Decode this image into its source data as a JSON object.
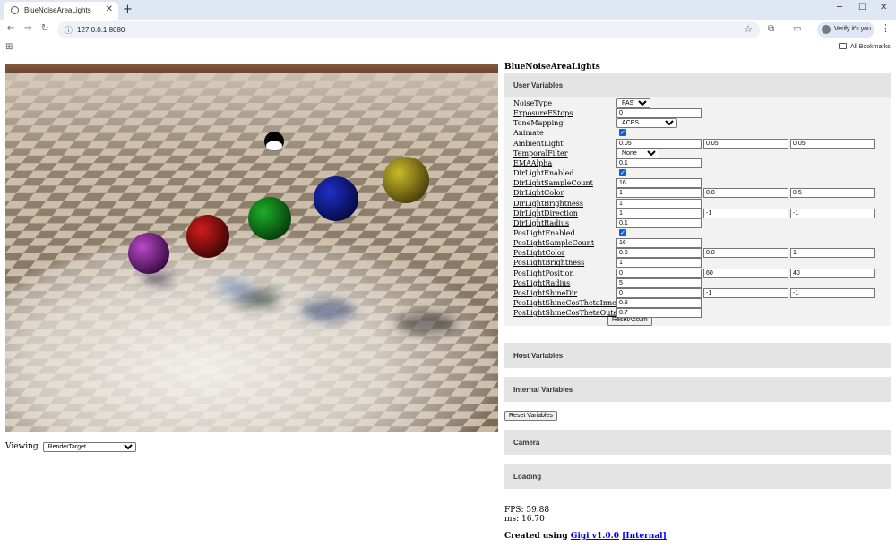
{
  "browser": {
    "tab_title": "BlueNoiseAreaLights",
    "url": "127.0.0.1:8080",
    "verify_label": "Verify it's you",
    "bookmarks_label": "All Bookmarks"
  },
  "viewing": {
    "label": "Viewing",
    "selected": "RenderTarget"
  },
  "panel": {
    "title": "BlueNoiseAreaLights",
    "sections": {
      "user_variables": "User Variables",
      "host_variables": "Host Variables",
      "internal_variables": "Internal Variables",
      "camera": "Camera",
      "loading": "Loading"
    },
    "variables": [
      {
        "name": "NoiseType",
        "type": "select",
        "value": "FAST IS"
      },
      {
        "name": "ExposureFStops",
        "type": "text",
        "values": [
          "0"
        ]
      },
      {
        "name": "ToneMapping",
        "type": "select",
        "value": "ACES"
      },
      {
        "name": "Animate",
        "type": "checkbox",
        "checked": true
      },
      {
        "name": "AmbientLight",
        "type": "text",
        "values": [
          "0.05",
          "0.05",
          "0.05"
        ]
      },
      {
        "name": "TemporalFilter",
        "type": "select",
        "value": "None"
      },
      {
        "name": "EMAAlpha",
        "type": "text",
        "values": [
          "0.1"
        ]
      },
      {
        "name": "DirLightEnabled",
        "type": "checkbox",
        "checked": true
      },
      {
        "name": "DirLightSampleCount",
        "type": "text",
        "values": [
          "16"
        ]
      },
      {
        "name": "DirLightColor",
        "type": "text",
        "values": [
          "1",
          "0.8",
          "0.5"
        ]
      },
      {
        "name": "DirLightBrightness",
        "type": "text",
        "values": [
          "1"
        ]
      },
      {
        "name": "DirLightDirection",
        "type": "text",
        "values": [
          "1",
          "-1",
          "-1"
        ]
      },
      {
        "name": "DirLightRadius",
        "type": "text",
        "values": [
          "0.1"
        ]
      },
      {
        "name": "PosLightEnabled",
        "type": "checkbox",
        "checked": true
      },
      {
        "name": "PosLightSampleCount",
        "type": "text",
        "values": [
          "16"
        ]
      },
      {
        "name": "PosLightColor",
        "type": "text",
        "values": [
          "0.5",
          "0.8",
          "1"
        ]
      },
      {
        "name": "PosLightBrightness",
        "type": "text",
        "values": [
          "1"
        ]
      },
      {
        "name": "PosLightPosition",
        "type": "text",
        "values": [
          "0",
          "60",
          "40"
        ]
      },
      {
        "name": "PosLightRadius",
        "type": "text",
        "values": [
          "5"
        ]
      },
      {
        "name": "PosLightShineDir",
        "type": "text",
        "values": [
          "0",
          "-1",
          "-1"
        ]
      },
      {
        "name": "PosLightShineCosThetaInner",
        "type": "text",
        "values": [
          "0.8"
        ]
      },
      {
        "name": "PosLightShineCosThetaOuter",
        "type": "text",
        "values": [
          "0.7"
        ]
      }
    ],
    "reset_accum_label": "ResetAccum",
    "reset_variables_label": "Reset Variables",
    "fps": "FPS: 59.88",
    "ms": "ms: 16.70",
    "created_prefix": "Created using ",
    "created_link": "Gigi v1.0.0",
    "created_internal": "[Internal]"
  },
  "colors": {
    "checkbox_accent": "#0b61d4",
    "section_bg": "#e4e4e4",
    "link": "#0000ee"
  },
  "scene": {
    "spheres": [
      "purple",
      "red",
      "green",
      "blue",
      "yellow",
      "white"
    ]
  }
}
